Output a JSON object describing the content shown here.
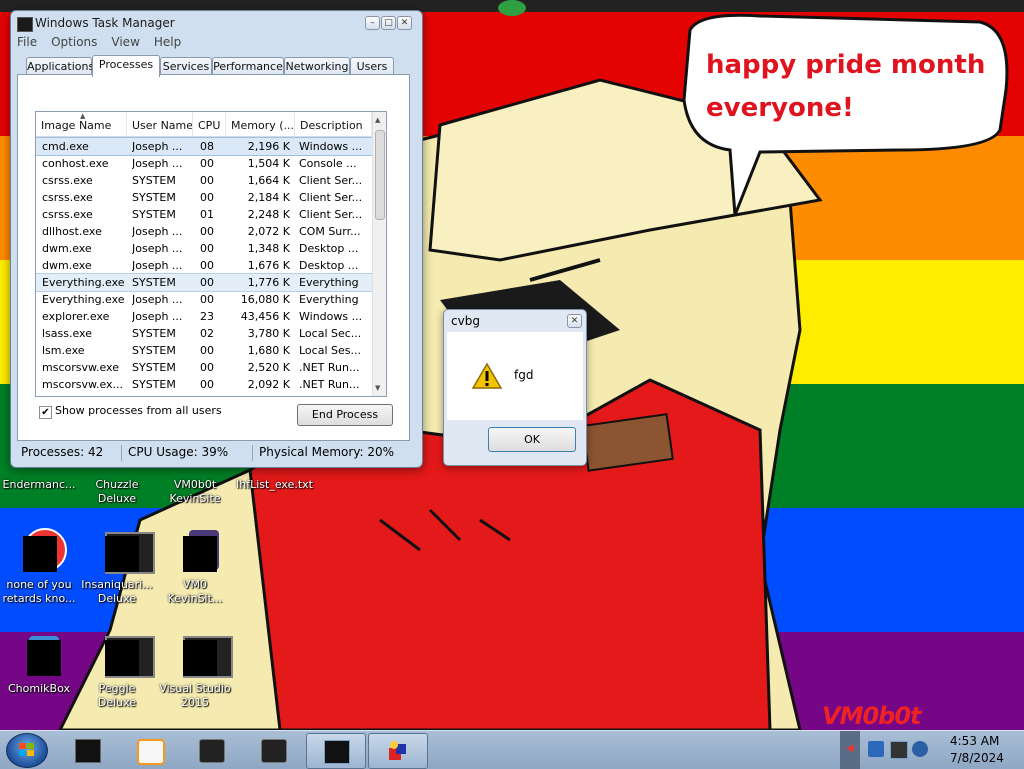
{
  "desktop": {
    "bubble_text": "happy pride month everyone!",
    "watermark": "VM0b0t",
    "icons": [
      {
        "label": "Endermanc..."
      },
      {
        "label": "Chuzzle Deluxe"
      },
      {
        "label": "VM0b0t KevinSite"
      },
      {
        "label": "IhfList_exe.txt"
      },
      {
        "label": "none of you retards kno..."
      },
      {
        "label": "Insaniquari... Deluxe"
      },
      {
        "label": "VM0 KevinSit..."
      },
      {
        "label": "ChomikBox"
      },
      {
        "label": "Peggle Deluxe"
      },
      {
        "label": "Visual Studio 2015"
      }
    ]
  },
  "task_manager": {
    "title": "Windows Task Manager",
    "menu": [
      "File",
      "Options",
      "View",
      "Help"
    ],
    "tabs": [
      "Applications",
      "Processes",
      "Services",
      "Performance",
      "Networking",
      "Users"
    ],
    "active_tab": "Processes",
    "columns": [
      "Image Name",
      "User Name",
      "CPU",
      "Memory (...",
      "Description"
    ],
    "processes": [
      {
        "name": "cmd.exe",
        "user": "Joseph ...",
        "cpu": "08",
        "mem": "2,196 K",
        "desc": "Windows ..."
      },
      {
        "name": "conhost.exe",
        "user": "Joseph ...",
        "cpu": "00",
        "mem": "1,504 K",
        "desc": "Console ..."
      },
      {
        "name": "csrss.exe",
        "user": "SYSTEM",
        "cpu": "00",
        "mem": "1,664 K",
        "desc": "Client Ser..."
      },
      {
        "name": "csrss.exe",
        "user": "SYSTEM",
        "cpu": "00",
        "mem": "2,184 K",
        "desc": "Client Ser..."
      },
      {
        "name": "csrss.exe",
        "user": "SYSTEM",
        "cpu": "01",
        "mem": "2,248 K",
        "desc": "Client Ser..."
      },
      {
        "name": "dllhost.exe",
        "user": "Joseph ...",
        "cpu": "00",
        "mem": "2,072 K",
        "desc": "COM Surr..."
      },
      {
        "name": "dwm.exe",
        "user": "Joseph ...",
        "cpu": "00",
        "mem": "1,348 K",
        "desc": "Desktop ..."
      },
      {
        "name": "dwm.exe",
        "user": "Joseph ...",
        "cpu": "00",
        "mem": "1,676 K",
        "desc": "Desktop ..."
      },
      {
        "name": "Everything.exe",
        "user": "SYSTEM",
        "cpu": "00",
        "mem": "1,776 K",
        "desc": "Everything"
      },
      {
        "name": "Everything.exe",
        "user": "Joseph ...",
        "cpu": "00",
        "mem": "16,080 K",
        "desc": "Everything"
      },
      {
        "name": "explorer.exe",
        "user": "Joseph ...",
        "cpu": "23",
        "mem": "43,456 K",
        "desc": "Windows ..."
      },
      {
        "name": "lsass.exe",
        "user": "SYSTEM",
        "cpu": "02",
        "mem": "3,780 K",
        "desc": "Local Sec..."
      },
      {
        "name": "lsm.exe",
        "user": "SYSTEM",
        "cpu": "00",
        "mem": "1,680 K",
        "desc": "Local Ses..."
      },
      {
        "name": "mscorsvw.exe",
        "user": "SYSTEM",
        "cpu": "00",
        "mem": "2,520 K",
        "desc": ".NET Run..."
      },
      {
        "name": "mscorsvw.ex...",
        "user": "SYSTEM",
        "cpu": "00",
        "mem": "2,092 K",
        "desc": ".NET Run..."
      }
    ],
    "show_all_label": "Show processes from all users",
    "show_all_checked": "✔",
    "end_process_label": "End Process",
    "status": {
      "processes": "Processes: 42",
      "cpu": "CPU Usage: 39%",
      "memory": "Physical Memory: 20%"
    }
  },
  "dialog": {
    "title": "cvbg",
    "message": "fgd",
    "ok_label": "OK"
  },
  "taskbar": {
    "time": "4:53 AM",
    "date": "7/8/2024"
  }
}
